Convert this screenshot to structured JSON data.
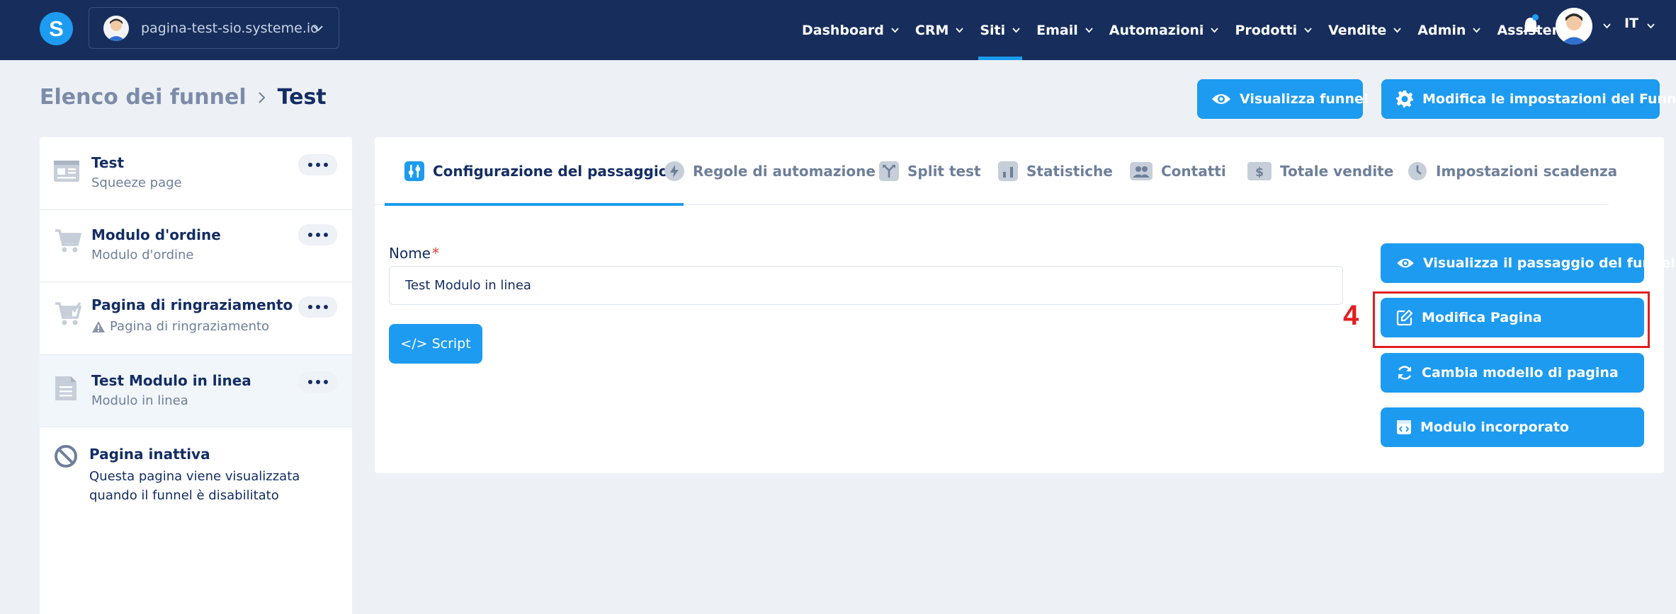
{
  "topbar": {
    "logo_letter": "S",
    "site": "pagina-test-sio.systeme.io",
    "nav": [
      {
        "label": "Dashboard"
      },
      {
        "label": "CRM"
      },
      {
        "label": "Siti",
        "active": true
      },
      {
        "label": "Email"
      },
      {
        "label": "Automazioni"
      },
      {
        "label": "Prodotti"
      },
      {
        "label": "Vendite"
      },
      {
        "label": "Admin"
      },
      {
        "label": "Assistenza"
      }
    ],
    "language": "IT",
    "accent_color": "#1d9bf0",
    "bg_color": "#172e5c"
  },
  "header": {
    "breadcrumb_parent": "Elenco dei funnel",
    "breadcrumb_current": "Test",
    "view_funnel_label": "Visualizza funnel",
    "funnel_settings_label": "Modifica le impostazioni del Funnel"
  },
  "sidebar": {
    "steps": [
      {
        "title": "Test",
        "subtitle": "Squeeze page",
        "icon": "squeeze-page-icon"
      },
      {
        "title": "Modulo d'ordine",
        "subtitle": "Modulo d'ordine",
        "icon": "cart-icon"
      },
      {
        "title": "Pagina di ringraziamento",
        "subtitle": "Pagina di ringraziamento",
        "icon": "cart-check-icon",
        "warning": true
      },
      {
        "title": "Test Modulo in linea",
        "subtitle": "Modulo in linea",
        "icon": "document-icon",
        "selected": true
      }
    ],
    "inactive": {
      "title": "Pagina inattiva",
      "description": "Questa pagina viene visualizzata quando il funnel è disabilitato"
    }
  },
  "main": {
    "tabs": [
      {
        "label": "Configurazione del passaggio",
        "active": true
      },
      {
        "label": "Regole di automazione"
      },
      {
        "label": "Split test"
      },
      {
        "label": "Statistiche"
      },
      {
        "label": "Contatti"
      },
      {
        "label": "Totale vendite"
      },
      {
        "label": "Impostazioni scadenza"
      }
    ],
    "name_label": "Nome",
    "name_required": "*",
    "name_value": "Test Modulo in linea",
    "script_label": "</> Script",
    "actions": {
      "view_step": "Visualizza il passaggio del funnel",
      "edit_page": "Modifica Pagina",
      "change_template": "Cambia modello di pagina",
      "embed_form": "Modulo incorporato"
    },
    "annotation_number": "4"
  }
}
